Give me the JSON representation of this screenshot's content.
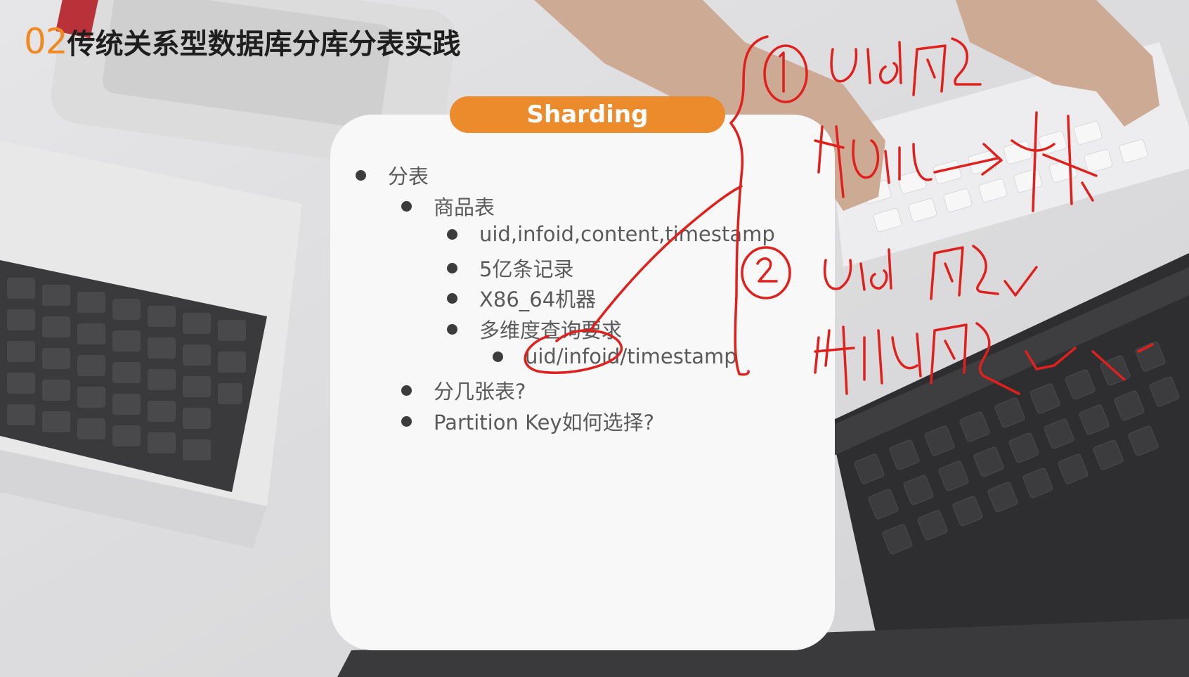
{
  "slide": {
    "number": "02",
    "title": "传统关系型数据库分库分表实践",
    "badge": "Sharding"
  },
  "bullets": {
    "l1_a": "分表",
    "l2_a": "商品表",
    "l3_a": "uid,infoid,content,timestamp",
    "l3_b": "5亿条记录",
    "l3_c": "X86_64机器",
    "l3_d": "多维度查询要求",
    "l4_a": "uid/infoid/timestamp",
    "l2_b": "分几张表?",
    "l2_c": "Partition Key如何选择?"
  },
  "annotation": {
    "circled_1": "①",
    "circled_2": "②"
  },
  "colors": {
    "accent": "#ee8a23",
    "ink": "#e0201c"
  }
}
